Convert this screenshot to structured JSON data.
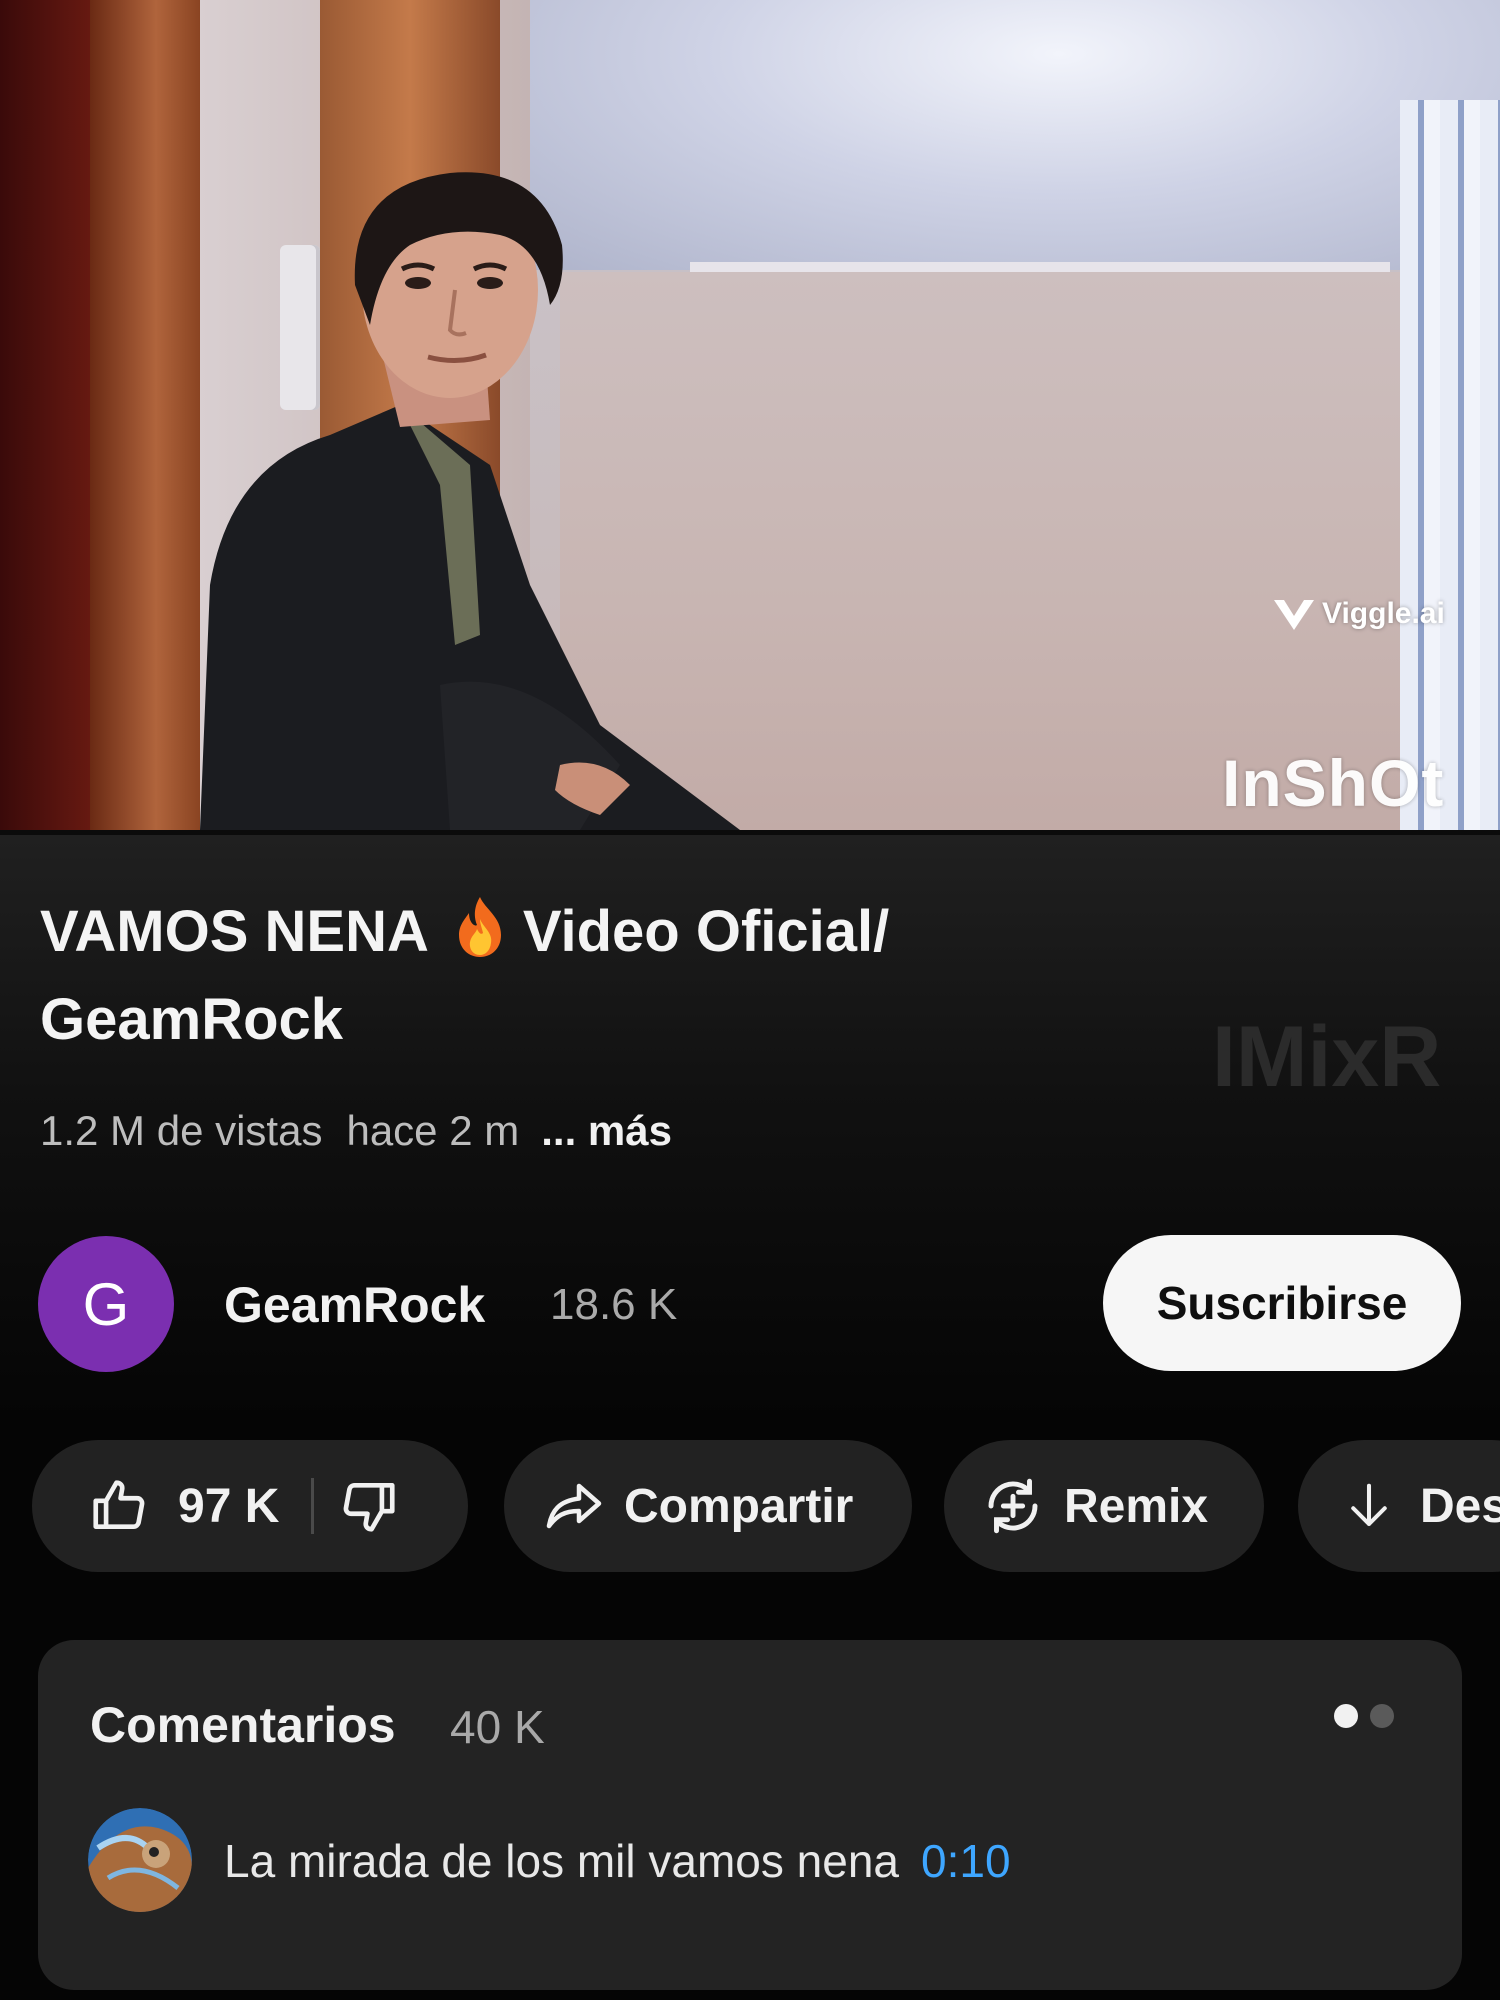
{
  "watermarks": {
    "viggle": "Viggle.ai",
    "inshot": "InShOt",
    "imixr": "IMixR"
  },
  "video": {
    "title_part1": "VAMOS NENA",
    "title_emoji_icon": "fire-icon",
    "title_part2": "Video Oficial/",
    "title_line2": "GeamRock",
    "views": "1.2 M de vistas",
    "age": "hace 2 m",
    "more": "... más"
  },
  "channel": {
    "avatar_letter": "G",
    "avatar_color": "#7b2fb0",
    "name": "GeamRock",
    "subscribers": "18.6 K",
    "subscribe_label": "Suscribirse"
  },
  "actions": {
    "likes": "97 K",
    "share_label": "Compartir",
    "remix_label": "Remix",
    "download_label": "Des"
  },
  "comments": {
    "title": "Comentarios",
    "count": "40 K",
    "top_comment": "La mirada de los mil vamos nena",
    "top_comment_timestamp": "0:10",
    "timestamp_color": "#3ea6ff"
  }
}
